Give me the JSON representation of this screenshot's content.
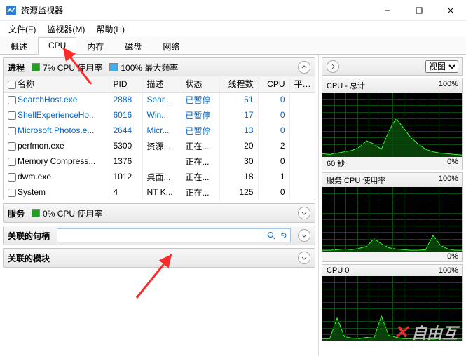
{
  "window": {
    "title": "资源监视器"
  },
  "menu": {
    "file": "文件(F)",
    "monitor": "监视器(M)",
    "help": "帮助(H)"
  },
  "tabs": {
    "overview": "概述",
    "cpu": "CPU",
    "memory": "内存",
    "disk": "磁盘",
    "network": "网络"
  },
  "processes": {
    "title": "进程",
    "usage_label": "7% CPU 使用率",
    "freq_label": "100% 最大频率",
    "usage_color": "#1fa01f",
    "freq_color": "#3cb0f2",
    "cols": {
      "name": "名称",
      "pid": "PID",
      "desc": "描述",
      "status": "状态",
      "threads": "线程数",
      "cpu": "CPU",
      "avg": "平…"
    },
    "rows": [
      {
        "name": "SearchHost.exe",
        "pid": "2888",
        "desc": "Sear...",
        "status": "已暂停",
        "threads": "51",
        "cpu": "0",
        "suspended": true
      },
      {
        "name": "ShellExperienceHo...",
        "pid": "6016",
        "desc": "Win...",
        "status": "已暂停",
        "threads": "17",
        "cpu": "0",
        "suspended": true
      },
      {
        "name": "Microsoft.Photos.e...",
        "pid": "2644",
        "desc": "Micr...",
        "status": "已暂停",
        "threads": "13",
        "cpu": "0",
        "suspended": true
      },
      {
        "name": "perfmon.exe",
        "pid": "5300",
        "desc": "资源...",
        "status": "正在...",
        "threads": "20",
        "cpu": "2",
        "suspended": false
      },
      {
        "name": "Memory Compress...",
        "pid": "1376",
        "desc": "",
        "status": "正在...",
        "threads": "30",
        "cpu": "0",
        "suspended": false
      },
      {
        "name": "dwm.exe",
        "pid": "1012",
        "desc": "桌面...",
        "status": "正在...",
        "threads": "18",
        "cpu": "1",
        "suspended": false
      },
      {
        "name": "System",
        "pid": "4",
        "desc": "NT K...",
        "status": "正在...",
        "threads": "125",
        "cpu": "0",
        "suspended": false
      }
    ]
  },
  "services": {
    "title": "服务",
    "usage_label": "0% CPU 使用率",
    "usage_color": "#1fa01f"
  },
  "handles": {
    "title": "关联的句柄",
    "placeholder": ""
  },
  "modules": {
    "title": "关联的模块"
  },
  "right": {
    "view_label": "视图",
    "charts": [
      {
        "title": "CPU - 总计",
        "pct": "100%",
        "foot_left": "60 秒",
        "foot_right": "0%"
      },
      {
        "title": "服务 CPU 使用率",
        "pct": "100%",
        "foot_left": "",
        "foot_right": "0%"
      },
      {
        "title": "CPU 0",
        "pct": "100%",
        "foot_left": "",
        "foot_right": ""
      }
    ]
  },
  "watermark": "自由互",
  "chart_data": [
    {
      "type": "line",
      "title": "CPU - 总计",
      "ylim": [
        0,
        100
      ],
      "xlabel": "60 秒",
      "series": [
        {
          "name": "cpu",
          "values": [
            5,
            4,
            6,
            8,
            10,
            15,
            25,
            20,
            12,
            40,
            60,
            45,
            30,
            20,
            12,
            8,
            6,
            5,
            4,
            3
          ]
        }
      ]
    },
    {
      "type": "line",
      "title": "服务 CPU 使用率",
      "ylim": [
        0,
        100
      ],
      "series": [
        {
          "name": "cpu",
          "values": [
            2,
            2,
            3,
            4,
            3,
            5,
            8,
            20,
            12,
            6,
            4,
            3,
            2,
            2,
            3,
            25,
            10,
            4,
            2,
            2
          ]
        }
      ]
    },
    {
      "type": "line",
      "title": "CPU 0",
      "ylim": [
        0,
        100
      ],
      "series": [
        {
          "name": "cpu",
          "values": [
            3,
            3,
            35,
            6,
            4,
            3,
            5,
            4,
            38,
            8,
            5,
            3,
            3,
            4,
            3,
            2,
            3,
            4,
            3,
            3
          ]
        }
      ]
    }
  ]
}
